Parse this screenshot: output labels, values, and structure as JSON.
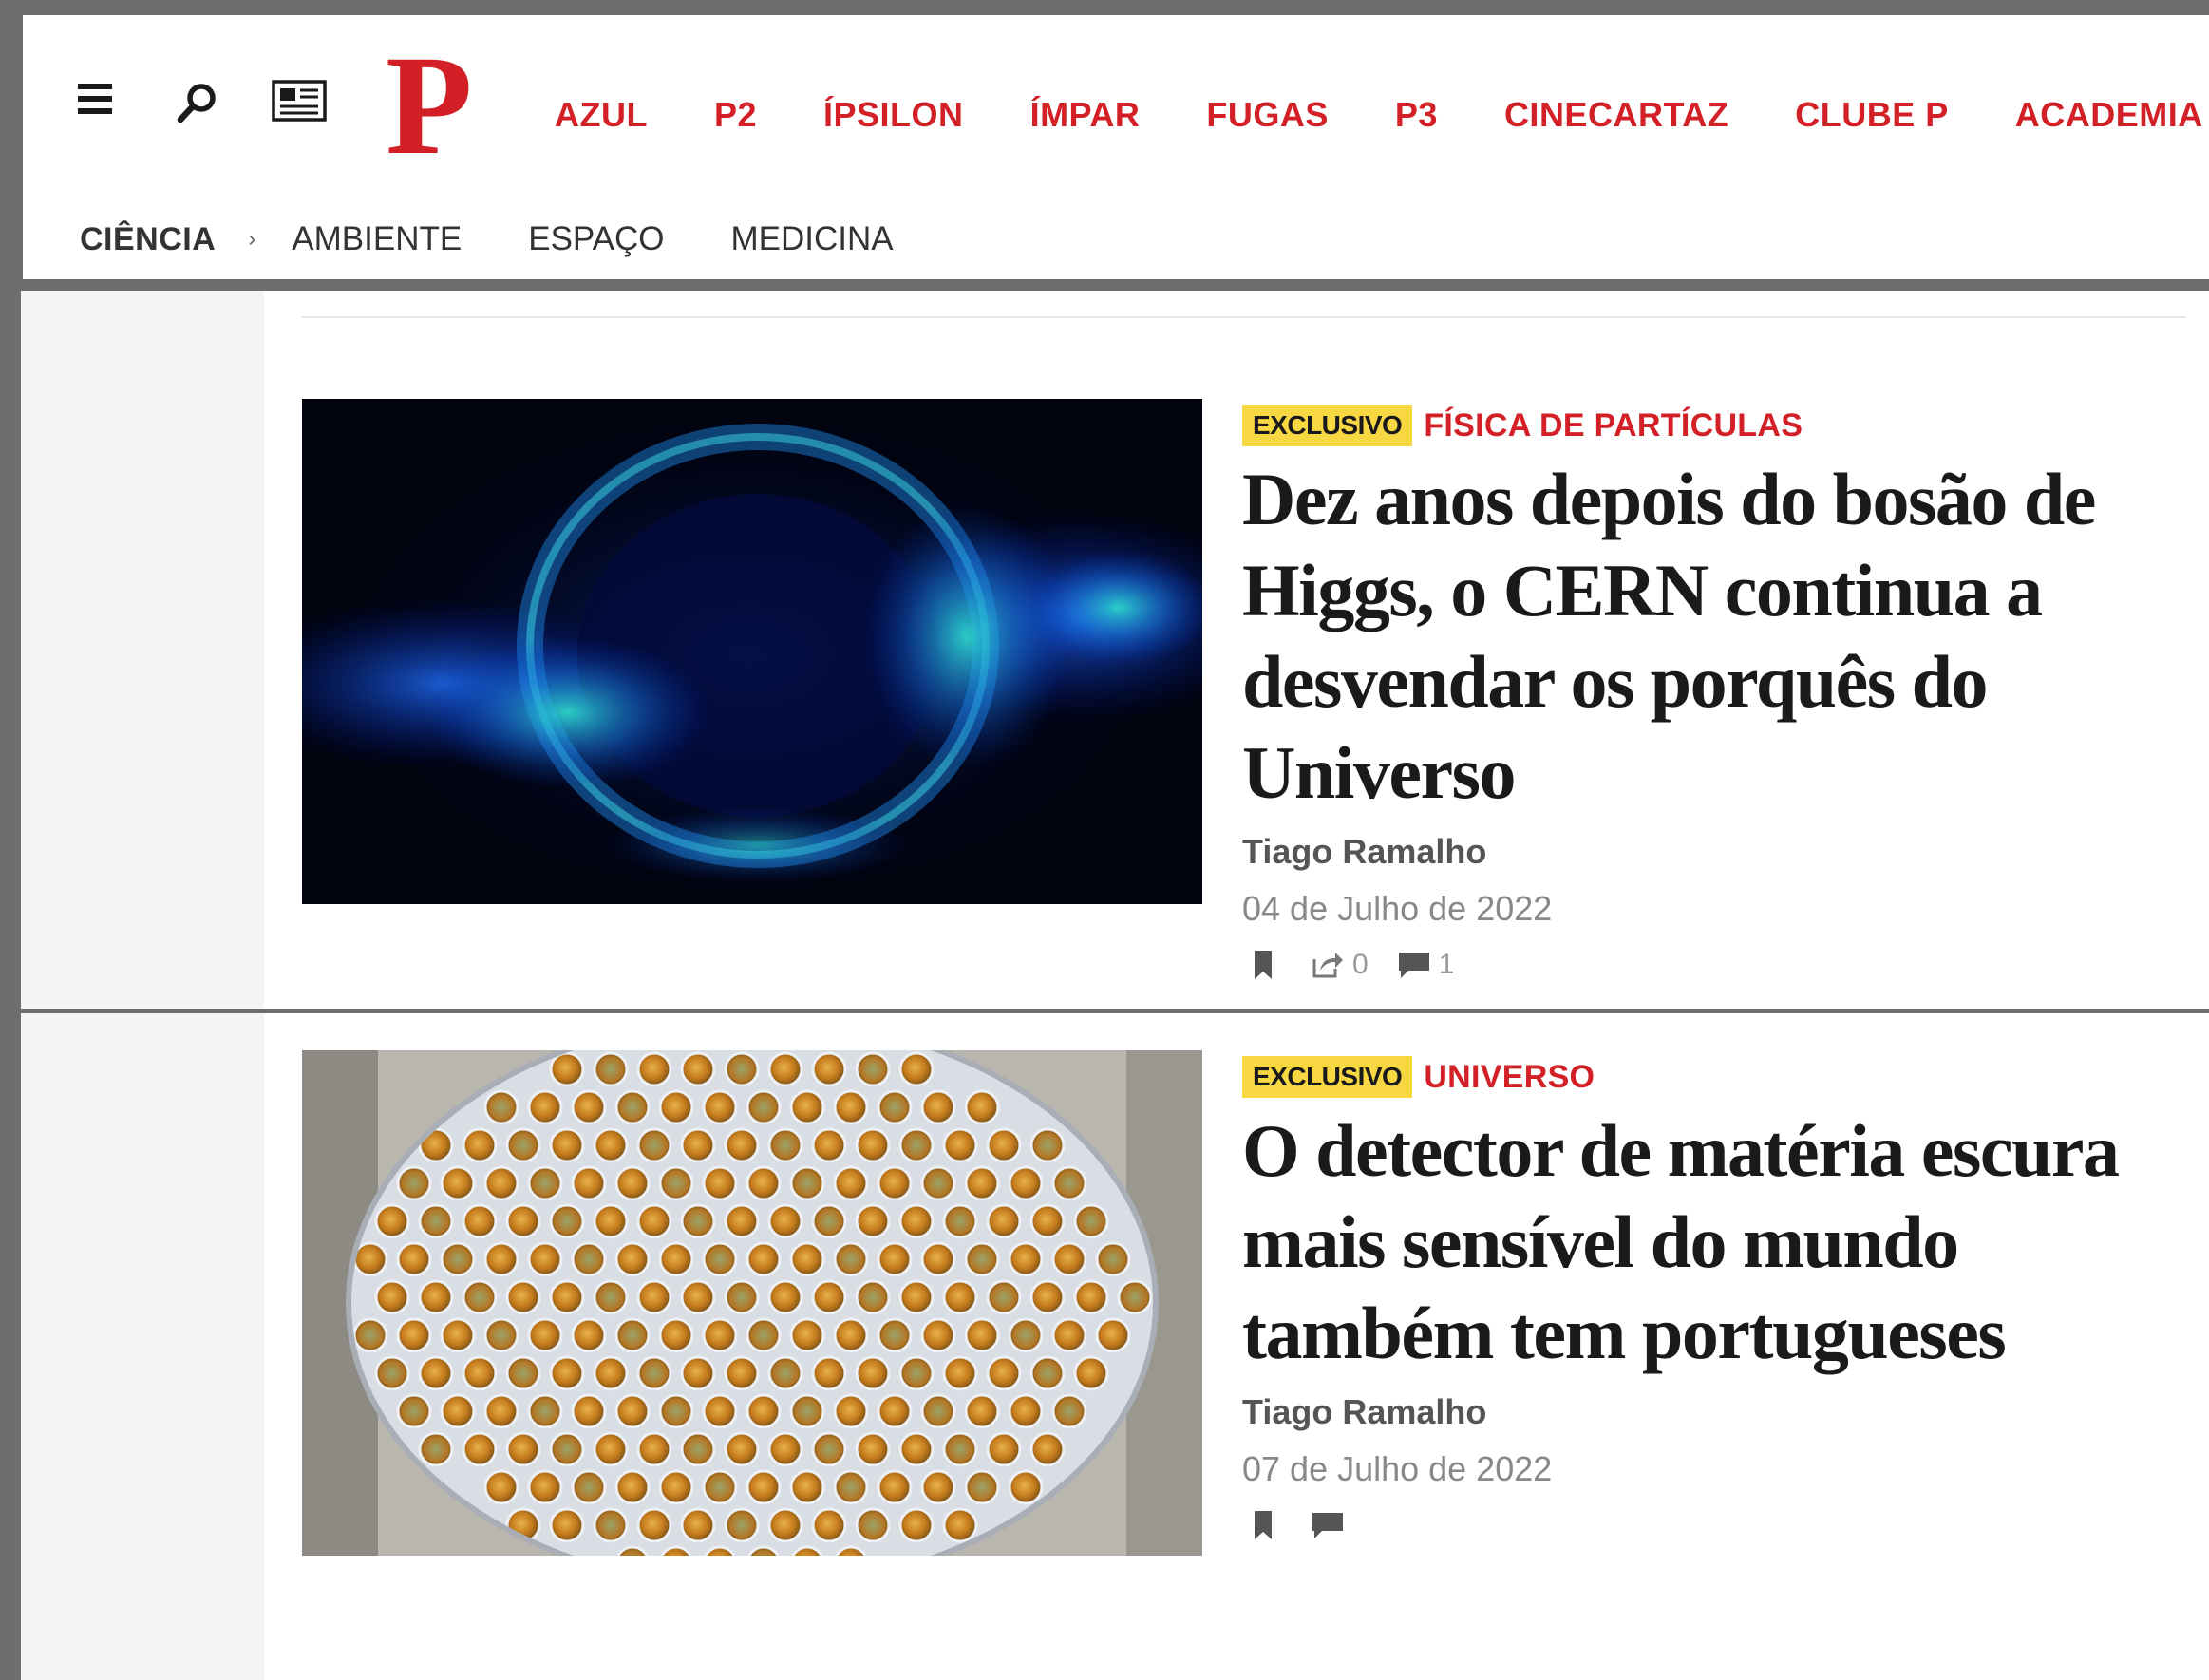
{
  "header": {
    "logo": "P",
    "top_nav": [
      "AZUL",
      "P2",
      "ÍPSILON",
      "ÍMPAR",
      "FUGAS",
      "P3",
      "CINECARTAZ",
      "CLUBE P",
      "ACADEMIA P"
    ],
    "section": "CIÊNCIA",
    "breadcrumb_separator": "›",
    "sub_nav": [
      "AMBIENTE",
      "ESPAÇO",
      "MEDICINA"
    ]
  },
  "colors": {
    "brand_red": "#d32027",
    "badge_yellow": "#f7d842"
  },
  "articles": [
    {
      "badge": "EXCLUSIVO",
      "category": "FÍSICA DE PARTÍCULAS",
      "headline": "Dez anos depois do bosão de Higgs, o CERN continua a desvendar os porquês do Universo",
      "author": "Tiago Ramalho",
      "date": "04 de Julho de 2022",
      "shares": "0",
      "comments": "1",
      "image": "blue-particle-cloud"
    },
    {
      "badge": "EXCLUSIVO",
      "category": "UNIVERSO",
      "headline": "O detector de matéria escura mais sensível do mundo também tem portugueses",
      "author": "Tiago Ramalho",
      "date": "07 de Julho de 2022",
      "image": "photomultiplier-array"
    }
  ],
  "icons": {
    "menu": "hamburger-menu-icon",
    "search": "search-icon",
    "edition": "newspaper-icon",
    "bookmark": "bookmark-icon",
    "share": "share-icon",
    "comment": "comment-icon"
  }
}
